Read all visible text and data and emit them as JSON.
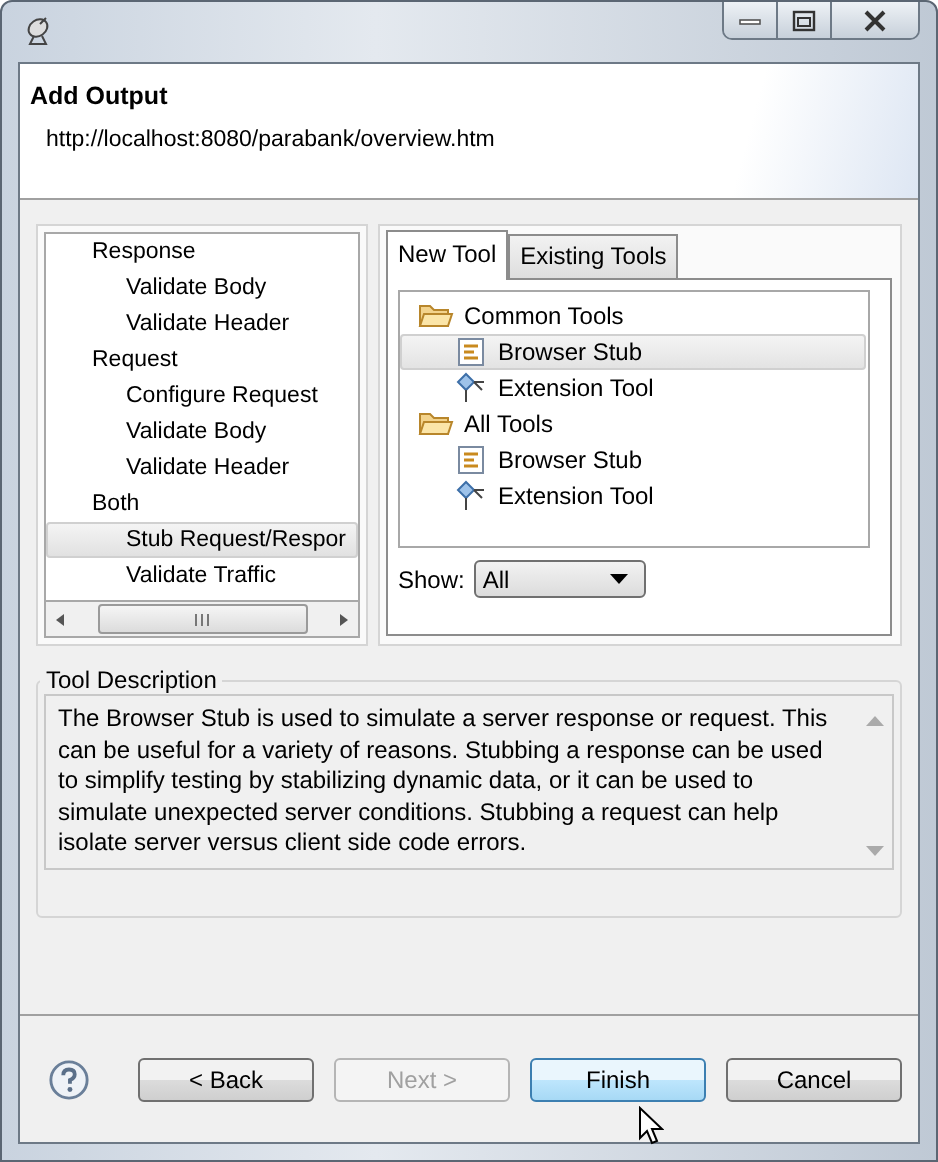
{
  "header": {
    "title": "Add Output",
    "subtitle": "http://localhost:8080/parabank/overview.htm"
  },
  "left_tree": [
    {
      "label": "Response",
      "selected": false,
      "children": [
        {
          "label": "Validate Body",
          "selected": false
        },
        {
          "label": "Validate Header",
          "selected": false
        }
      ]
    },
    {
      "label": "Request",
      "selected": false,
      "children": [
        {
          "label": "Configure Request",
          "selected": false
        },
        {
          "label": "Validate Body",
          "selected": false
        },
        {
          "label": "Validate Header",
          "selected": false
        }
      ]
    },
    {
      "label": "Both",
      "selected": false,
      "children": [
        {
          "label": "Stub Request/Respor",
          "selected": true
        },
        {
          "label": "Validate Traffic",
          "selected": false
        }
      ]
    }
  ],
  "tabs": [
    {
      "label": "New Tool",
      "selected": true
    },
    {
      "label": "Existing Tools",
      "selected": false
    }
  ],
  "tool_tree": [
    {
      "label": "Common Tools",
      "kind": "folder",
      "selected": false,
      "children": [
        {
          "label": "Browser Stub",
          "kind": "stub",
          "selected": true
        },
        {
          "label": "Extension Tool",
          "kind": "extension",
          "selected": false
        }
      ]
    },
    {
      "label": "All Tools",
      "kind": "folder",
      "selected": false,
      "children": [
        {
          "label": "Browser Stub",
          "kind": "stub",
          "selected": false
        },
        {
          "label": "Extension Tool",
          "kind": "extension",
          "selected": false
        }
      ]
    }
  ],
  "show": {
    "label": "Show:",
    "value": "All"
  },
  "description": {
    "title": "Tool Description",
    "text": "The Browser Stub is used to simulate a server response or request.  This can be useful for a variety of reasons.  Stubbing a response can be used to simplify testing by stabilizing dynamic data, or it can be used to simulate unexpected server conditions.  Stubbing a request can help isolate server versus client side code errors."
  },
  "buttons": [
    {
      "label": "< Back",
      "disabled": false,
      "focused": false
    },
    {
      "label": "Next >",
      "disabled": true,
      "focused": false
    },
    {
      "label": "Finish",
      "disabled": false,
      "focused": true
    },
    {
      "label": "Cancel",
      "disabled": false,
      "focused": false
    }
  ]
}
